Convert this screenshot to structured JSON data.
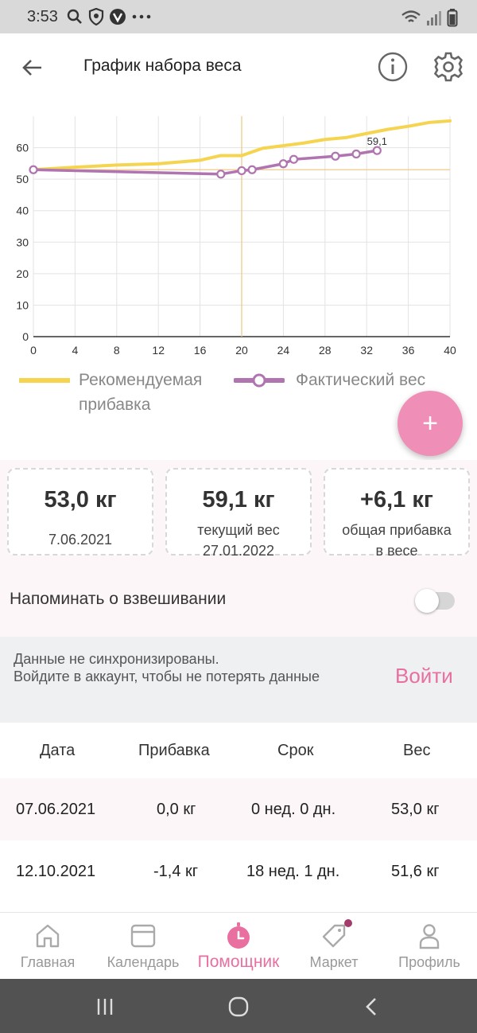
{
  "status_bar": {
    "time": "3:53"
  },
  "app_bar": {
    "title": "График набора веса"
  },
  "chart_data": {
    "type": "line",
    "xlabel": "",
    "ylabel": "",
    "xlim": [
      0,
      40
    ],
    "ylim": [
      0,
      70
    ],
    "x_ticks": [
      0,
      4,
      8,
      12,
      16,
      20,
      24,
      28,
      32,
      36,
      40
    ],
    "y_ticks": [
      0,
      10,
      20,
      30,
      40,
      50,
      60
    ],
    "grid": true,
    "legend_position": "bottom",
    "crosshair": {
      "x": 20,
      "y": 53
    },
    "series": [
      {
        "name": "Рекомендуемая прибавка",
        "color": "#f5d44f",
        "points": [
          [
            0,
            53
          ],
          [
            4,
            53.8
          ],
          [
            8,
            54.5
          ],
          [
            12,
            54.9
          ],
          [
            16,
            56
          ],
          [
            18,
            57.5
          ],
          [
            20,
            57.5
          ],
          [
            22,
            59.8
          ],
          [
            26,
            61.5
          ],
          [
            28,
            62.6
          ],
          [
            30,
            63.2
          ],
          [
            32,
            64.5
          ],
          [
            34,
            65.8
          ],
          [
            36,
            66.8
          ],
          [
            38,
            68
          ],
          [
            40,
            68.5
          ]
        ]
      },
      {
        "name": "Фактический вес",
        "color": "#b074b0",
        "points": [
          [
            0,
            53
          ],
          [
            18,
            51.6
          ],
          [
            20,
            52.7
          ],
          [
            21,
            53
          ],
          [
            24,
            54.9
          ],
          [
            25,
            56.3
          ],
          [
            29,
            57.3
          ],
          [
            31,
            58
          ],
          [
            33,
            59.1
          ]
        ]
      }
    ],
    "annotations": [
      {
        "x": 33,
        "y": 59.1,
        "text": "59,1"
      }
    ]
  },
  "fab": {
    "label": "+"
  },
  "stats": [
    {
      "value": "53,0 кг",
      "sub1": "",
      "sub2": "7.06.2021"
    },
    {
      "value": "59,1 кг",
      "sub1": "текущий вес",
      "sub2": "27.01.2022"
    },
    {
      "value": "+6,1 кг",
      "sub1": "общая прибавка",
      "sub2": "в весе"
    }
  ],
  "reminder": {
    "label": "Напоминать о взвешивании",
    "enabled": false
  },
  "sync": {
    "line1": "Данные не синхронизированы.",
    "line2": "Войдите в аккаунт, чтобы не потерять данные",
    "login": "Войти"
  },
  "table": {
    "headers": [
      "Дата",
      "Прибавка",
      "Срок",
      "Вес"
    ],
    "rows": [
      [
        "07.06.2021",
        "0,0 кг",
        "0 нед. 0 дн.",
        "53,0 кг"
      ],
      [
        "12.10.2021",
        "-1,4 кг",
        "18 нед. 1 дн.",
        "51,6 кг"
      ]
    ]
  },
  "bottom_nav": [
    {
      "label": "Главная",
      "icon": "home-icon",
      "active": false
    },
    {
      "label": "Календарь",
      "icon": "calendar-icon",
      "active": false
    },
    {
      "label": "Помощник",
      "icon": "assistant-clock-icon",
      "active": true
    },
    {
      "label": "Маркет",
      "icon": "tag-icon",
      "active": false,
      "badge": true
    },
    {
      "label": "Профиль",
      "icon": "profile-icon",
      "active": false
    }
  ],
  "colors": {
    "accent": "#e86fa0",
    "recommended": "#f5d44f",
    "actual": "#b074b0",
    "fab": "#ef8fb7"
  }
}
